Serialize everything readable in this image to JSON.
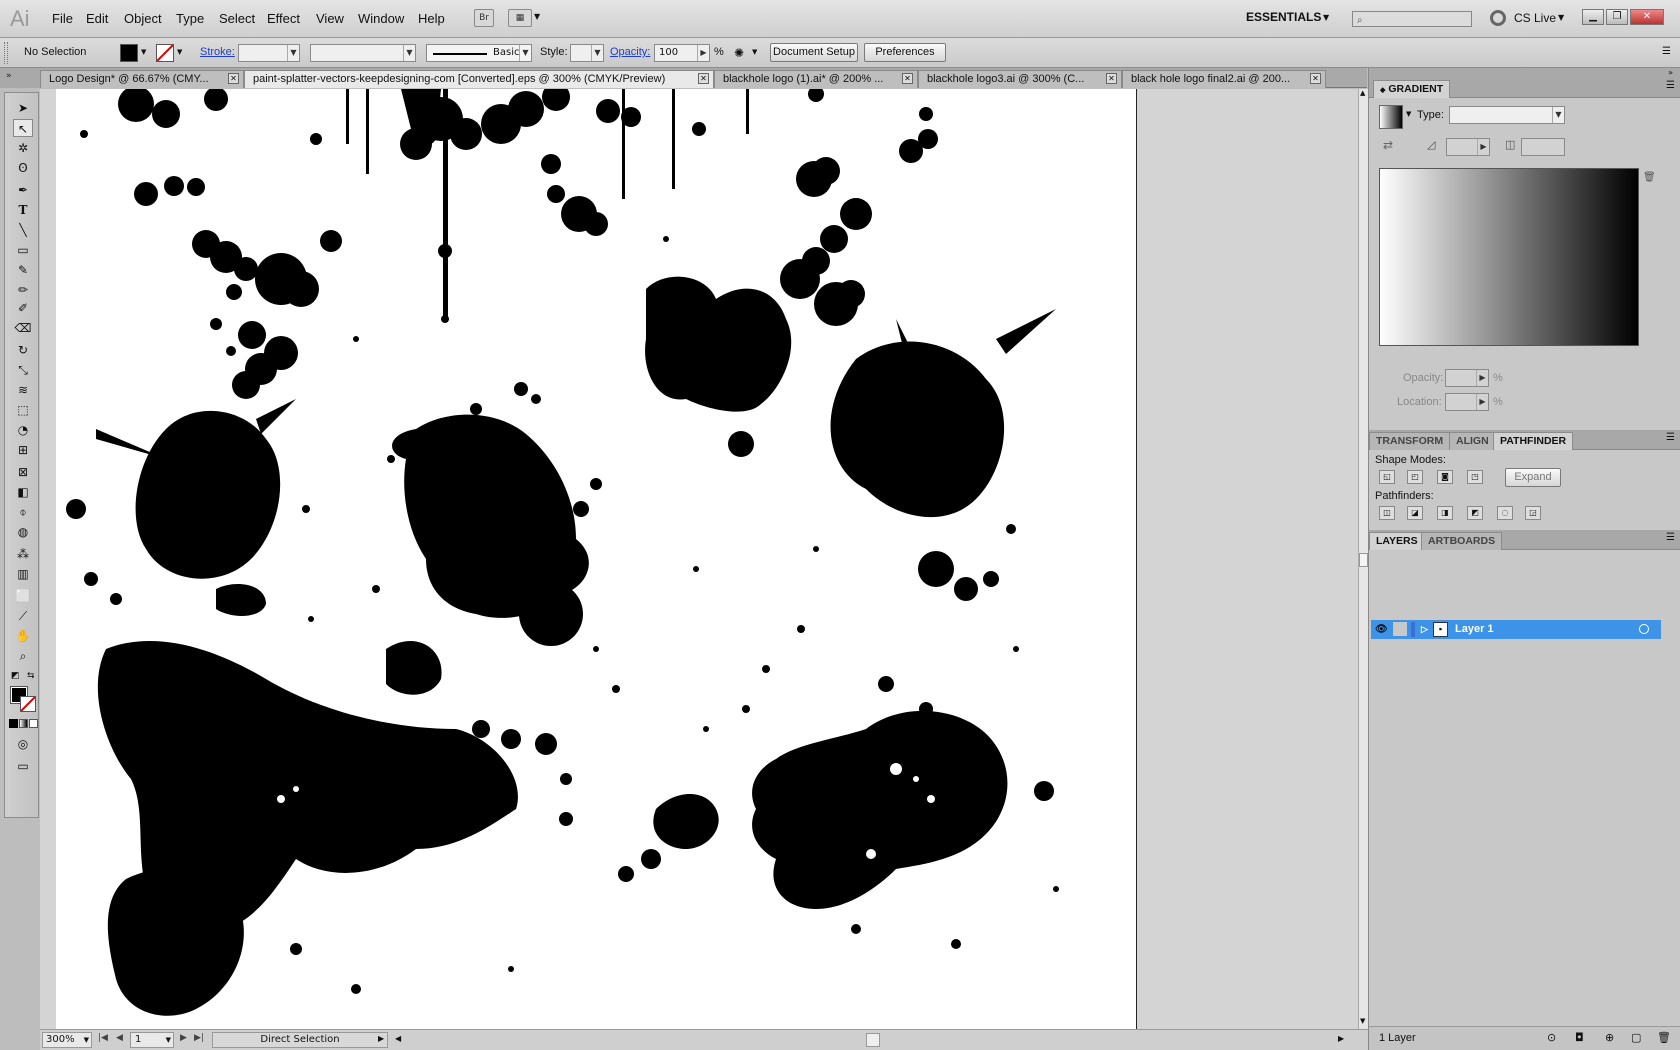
{
  "app": {
    "logo": "Ai"
  },
  "menu": {
    "items": [
      "File",
      "Edit",
      "Object",
      "Type",
      "Select",
      "Effect",
      "View",
      "Window",
      "Help"
    ],
    "bridge_button": "Br",
    "workspace": "ESSENTIALS",
    "search_placeholder": "",
    "cs_live": "CS Live"
  },
  "control": {
    "selection": "No Selection",
    "stroke_label": "Stroke:",
    "brush_label": "Basic",
    "style_label": "Style:",
    "opacity_label": "Opacity:",
    "opacity_value": "100",
    "opacity_unit": "%",
    "document_setup": "Document Setup",
    "preferences": "Preferences"
  },
  "tabs": [
    {
      "label": "Logo Design* @ 66.67% (CMY...",
      "active": false
    },
    {
      "label": "paint-splatter-vectors-keepdesigning-com [Converted].eps @ 300% (CMYK/Preview)",
      "active": true
    },
    {
      "label": "blackhole logo (1).ai* @ 200% ...",
      "active": false
    },
    {
      "label": "blackhole logo3.ai @ 300% (C...",
      "active": false
    },
    {
      "label": "black hole logo final2.ai @ 200...",
      "active": false
    }
  ],
  "status": {
    "zoom": "300%",
    "artboard": "1",
    "tool": "Direct Selection"
  },
  "gradient_panel": {
    "title": "GRADIENT",
    "type_label": "Type:",
    "opacity_label": "Opacity:",
    "location_label": "Location:",
    "percent": "%"
  },
  "pathfinder_panel": {
    "tabs": [
      "TRANSFORM",
      "ALIGN",
      "PATHFINDER"
    ],
    "shape_modes": "Shape Modes:",
    "expand": "Expand",
    "pathfinders": "Pathfinders:"
  },
  "layers_panel": {
    "tabs": [
      "LAYERS",
      "ARTBOARDS"
    ],
    "layer_name": "Layer 1",
    "count": "1 Layer"
  },
  "colors": {
    "selection_blue": "#3d93e8",
    "link_blue": "#1d3fd0"
  }
}
